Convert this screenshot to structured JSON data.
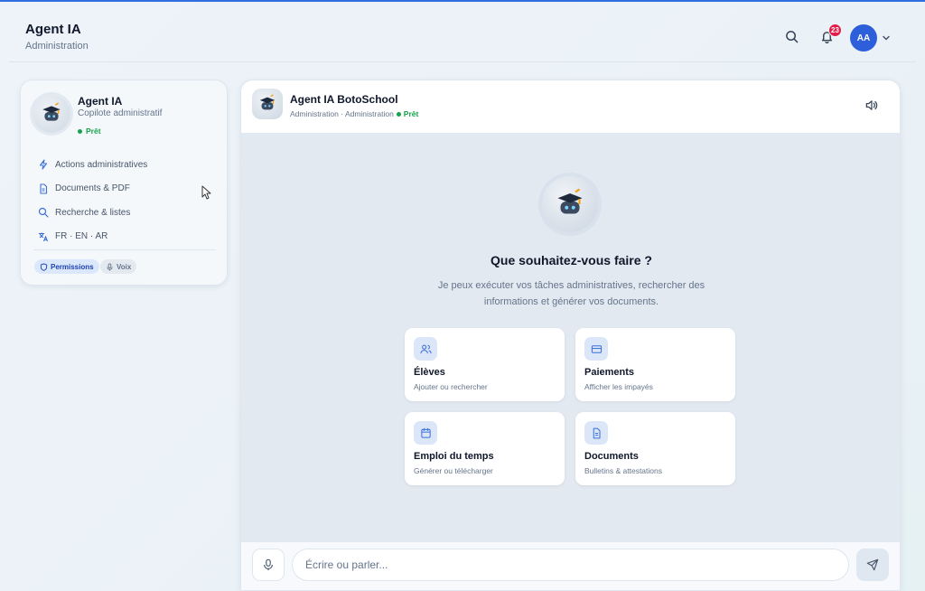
{
  "header": {
    "title": "Agent IA",
    "subtitle": "Administration",
    "notifications_count": "23",
    "user_initials": "AA"
  },
  "sidebar": {
    "name": "Agent IA",
    "role": "Copilote administratif",
    "status": "Prêt",
    "items": [
      {
        "label": "Actions administratives",
        "icon": "lightning-icon"
      },
      {
        "label": "Documents & PDF",
        "icon": "document-icon"
      },
      {
        "label": "Recherche & listes",
        "icon": "search-icon"
      },
      {
        "label": "FR · EN · AR",
        "icon": "translate-icon"
      }
    ],
    "chips": {
      "permissions": "Permissions",
      "voice": "Voix"
    }
  },
  "chat": {
    "title": "Agent IA BotoSchool",
    "subtitle": "Administration · Administration",
    "status": "Prêt",
    "hero_title": "Que souhaitez-vous faire ?",
    "hero_description": "Je peux exécuter vos tâches administratives, rechercher des informations et générer vos documents.",
    "actions": [
      {
        "title": "Élèves",
        "subtitle": "Ajouter ou rechercher",
        "icon": "users-icon"
      },
      {
        "title": "Paiements",
        "subtitle": "Afficher les impayés",
        "icon": "credit-card-icon"
      },
      {
        "title": "Emploi du temps",
        "subtitle": "Générer ou télécharger",
        "icon": "calendar-icon"
      },
      {
        "title": "Documents",
        "subtitle": "Bulletins & attestations",
        "icon": "document-icon"
      }
    ],
    "input_placeholder": "Écrire ou parler..."
  },
  "colors": {
    "accent": "#2c5fd9",
    "status_ready": "#16a34a",
    "badge": "#e11d48"
  }
}
